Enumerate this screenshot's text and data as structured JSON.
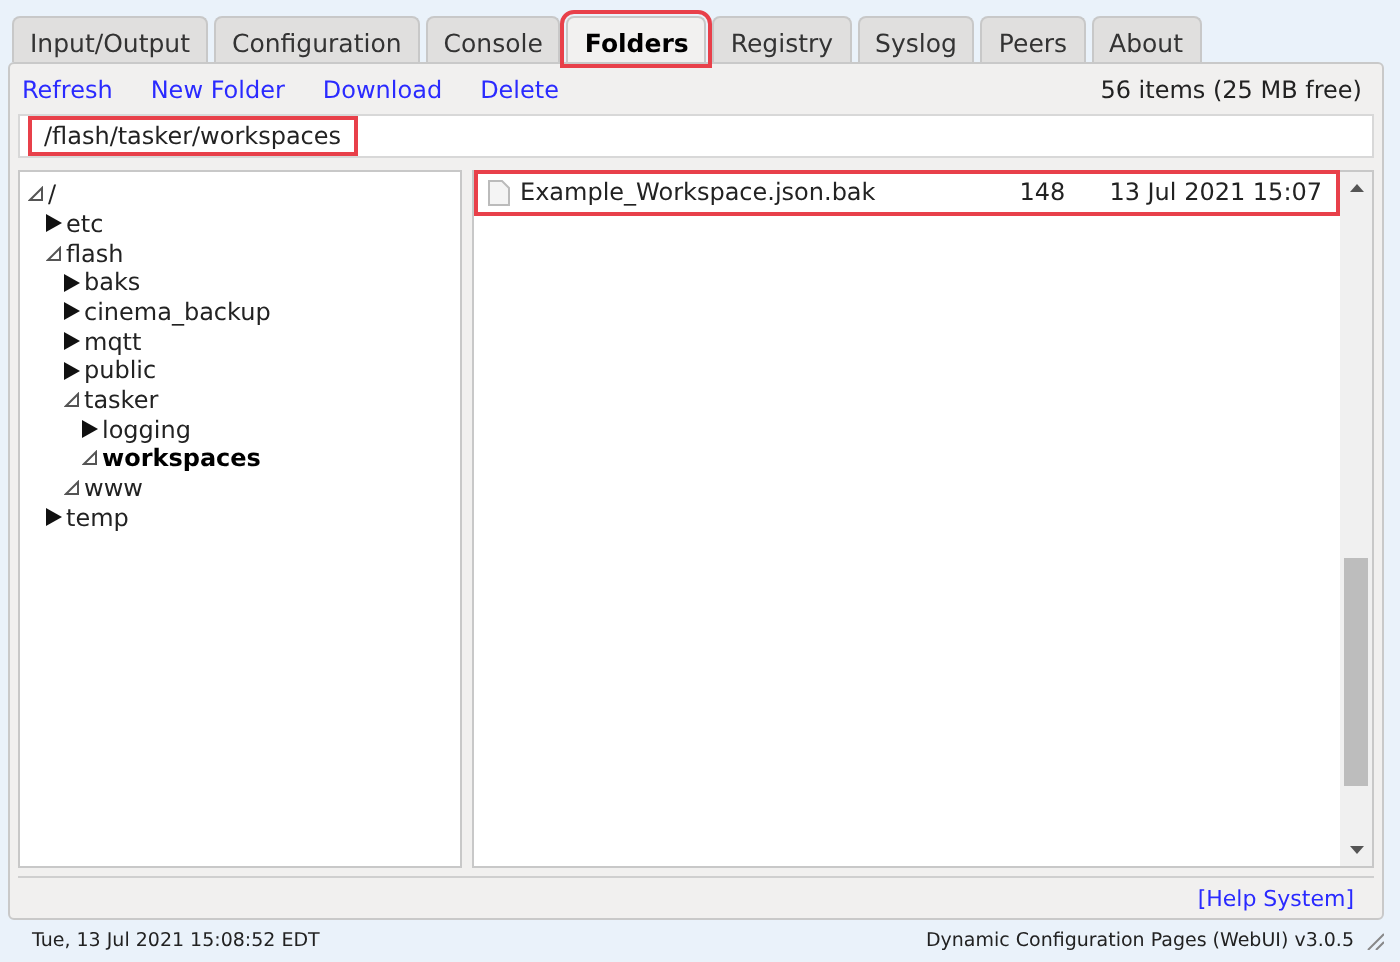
{
  "tabs": [
    {
      "label": "Input/Output",
      "selected": false,
      "highlighted": false
    },
    {
      "label": "Configuration",
      "selected": false,
      "highlighted": false
    },
    {
      "label": "Console",
      "selected": false,
      "highlighted": false
    },
    {
      "label": "Folders",
      "selected": true,
      "highlighted": true
    },
    {
      "label": "Registry",
      "selected": false,
      "highlighted": false
    },
    {
      "label": "Syslog",
      "selected": false,
      "highlighted": false
    },
    {
      "label": "Peers",
      "selected": false,
      "highlighted": false
    },
    {
      "label": "About",
      "selected": false,
      "highlighted": false
    }
  ],
  "toolbar": {
    "actions": [
      "Refresh",
      "New Folder",
      "Download",
      "Delete"
    ],
    "item_count": "56 items (25 MB free)"
  },
  "path_field": {
    "value": "/flash/tasker/workspaces",
    "highlighted": true
  },
  "tree": [
    {
      "label": "/",
      "expanded": true,
      "selected": false,
      "children": [
        {
          "label": "etc",
          "expanded": false,
          "selected": false
        },
        {
          "label": "flash",
          "expanded": true,
          "selected": false,
          "children": [
            {
              "label": "baks",
              "expanded": false,
              "selected": false
            },
            {
              "label": "cinema_backup",
              "expanded": false,
              "selected": false
            },
            {
              "label": "mqtt",
              "expanded": false,
              "selected": false
            },
            {
              "label": "public",
              "expanded": false,
              "selected": false
            },
            {
              "label": "tasker",
              "expanded": true,
              "selected": false,
              "children": [
                {
                  "label": "logging",
                  "expanded": false,
                  "selected": false
                },
                {
                  "label": "workspaces",
                  "expanded": true,
                  "selected": true
                }
              ]
            },
            {
              "label": "www",
              "expanded": true,
              "selected": false
            }
          ]
        },
        {
          "label": "temp",
          "expanded": false,
          "selected": false
        }
      ]
    }
  ],
  "files": [
    {
      "name": "Example_Workspace.json.bak",
      "size": "148",
      "modified": "13 Jul 2021 15:07",
      "highlighted": true
    }
  ],
  "help_link": "[Help System]",
  "status_bar": {
    "time": "Tue, 13 Jul 2021 15:08:52 EDT",
    "version": "Dynamic Configuration Pages (WebUI) v3.0.5"
  }
}
